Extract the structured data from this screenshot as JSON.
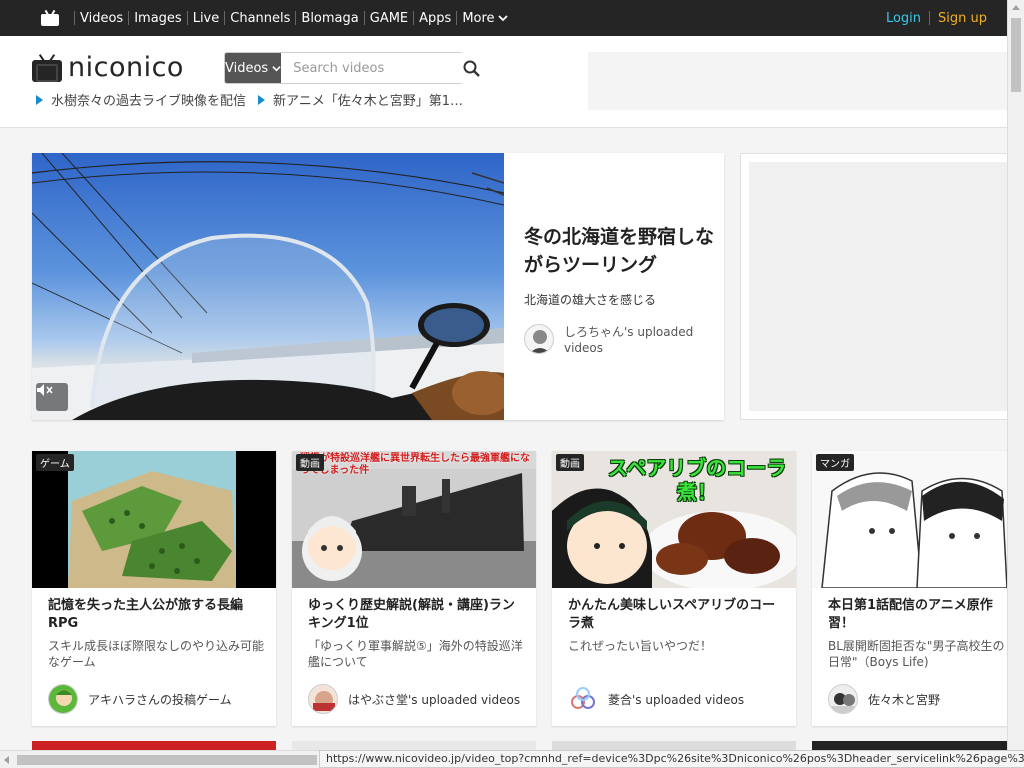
{
  "topnav": {
    "items": [
      "Videos",
      "Images",
      "Live",
      "Channels",
      "Blomaga",
      "GAME",
      "Apps"
    ],
    "more_label": "More",
    "login": "Login",
    "signup": "Sign up"
  },
  "header": {
    "logo_text": "niconico",
    "search": {
      "category": "Videos",
      "placeholder": "Search videos"
    },
    "tickers": [
      "水樹奈々の過去ライブ映像を配信",
      "新アニメ「佐々木と宮野」第1…"
    ]
  },
  "hero": {
    "title": "冬の北海道を野宿しながらツーリング",
    "subtitle": "北海道の雄大さを感じる",
    "owner": "しろちゃん's uploaded videos"
  },
  "cards": [
    {
      "tag": "ゲーム",
      "title": "記憶を失った主人公が旅する長編RPG",
      "desc": "スキル成長ほぼ際限なしのやり込み可能なゲーム",
      "owner": "アキハラさんの投稿ゲーム"
    },
    {
      "tag": "動画",
      "thumb_caption": "戦艦が特設巡洋艦に異世界転生したら最強軍艦になってしまった件",
      "title": "ゆっくり歴史解説(解説・講座)ランキング1位",
      "desc": "「ゆっくり軍事解説⑤」海外の特設巡洋艦について",
      "owner": "はやぶさ堂's uploaded videos"
    },
    {
      "tag": "動画",
      "thumb_caption": "スペアリブのコーラ煮！",
      "title": "かんたん美味しいスペアリブのコーラ煮",
      "desc": "これぜったい旨いやつだ！",
      "owner": "菱合's uploaded videos"
    },
    {
      "tag": "マンガ",
      "title": "本日第1話配信のアニメ原作習！",
      "desc": "BL展開断固拒否な\"男子高校生の日常\"（Boys Life)",
      "owner": "佐々木と宮野"
    }
  ],
  "status_url": "https://www.nicovideo.jp/video_top?cmnhd_ref=device%3Dpc%26site%3Dniconico%26pos%3Dheader_servicelink%26page%3Dtop",
  "colors": {
    "topbar": "#252525",
    "login": "#36c8e8",
    "signup": "#f0b020",
    "ticker_arrow": "#1a8ccc"
  }
}
